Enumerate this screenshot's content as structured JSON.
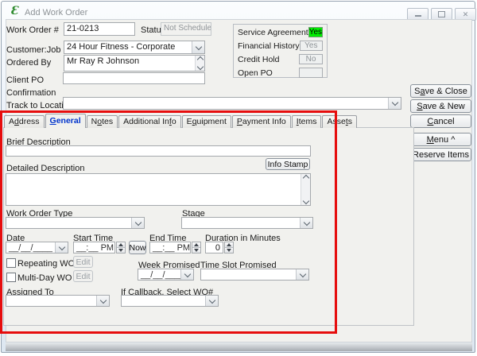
{
  "window": {
    "title": "Add Work Order",
    "logo_icon": "script-e-logo",
    "logo_glyph": "Ɛ",
    "controls": [
      {
        "name": "minimize"
      },
      {
        "name": "maximize"
      },
      {
        "name": "close",
        "glyph": "✕"
      }
    ]
  },
  "colors": {
    "service_agreement_green": "#00ee00",
    "annotation_red": "#e60d0d",
    "selected_tab_blue": "#0033cc"
  },
  "fields": {
    "work_order_number": {
      "label": "Work Order #",
      "value": "21-0213"
    },
    "status": {
      "label": "Status",
      "value": "Not Scheduled"
    },
    "customer_job": {
      "label": "Customer:Job",
      "value": "24 Hour Fitness - Corporate"
    },
    "ordered_by": {
      "label": "Ordered By",
      "value": "Mr Ray R Johnson"
    },
    "client_po": {
      "label": "Client PO",
      "value": ""
    },
    "confirmation": {
      "label": "Confirmation"
    },
    "track_to_location": {
      "label": "Track to Location",
      "value": ""
    }
  },
  "summary_panel": {
    "rows": [
      {
        "label": "Service Agreement",
        "value": "Yes",
        "state": "highlight"
      },
      {
        "label": "Financial History",
        "value": "Yes",
        "state": "normal"
      },
      {
        "label": "Credit Hold",
        "value": "No",
        "state": "normal"
      },
      {
        "label": "Open PO",
        "value": "",
        "state": "normal"
      }
    ]
  },
  "action_buttons": [
    {
      "label": "S&ave && Close"
    },
    {
      "label": "&Save && New"
    },
    {
      "label": "&Cancel"
    },
    {
      "label": "&Menu ^"
    },
    {
      "label": "Reserve Items"
    }
  ],
  "tab_bar": {
    "selected": "General",
    "tabs": [
      {
        "label": "A&ddress"
      },
      {
        "label": "&General",
        "selected": true
      },
      {
        "label": "N&otes"
      },
      {
        "label": "Additional In&fo"
      },
      {
        "label": "E&quipment"
      },
      {
        "label": "&Payment Info"
      },
      {
        "label": "&Items"
      },
      {
        "label": "Asse&ts"
      }
    ]
  },
  "general_tab": {
    "brief_description": {
      "label": "Brief Description",
      "value": ""
    },
    "info_stamp_button": "Info Stamp",
    "detailed_description": {
      "label": "Detailed Description",
      "value": ""
    },
    "work_order_type": {
      "label": "Work Order Type",
      "value": ""
    },
    "stage": {
      "label": "Stage",
      "value": ""
    },
    "date": {
      "label": "Date",
      "value": "__/__/____"
    },
    "start_time": {
      "label": "Start Time",
      "value": "__:__ PM"
    },
    "now_button": "Now",
    "end_time": {
      "label": "End Time",
      "value": "__:__ PM"
    },
    "duration": {
      "label": "Duration in Minutes",
      "value": "0"
    },
    "repeating_wo": {
      "label": "Repeating WO",
      "checked": false,
      "edit_button": "Edit"
    },
    "multi_day_wo": {
      "label": "Multi-Day WO",
      "checked": false,
      "edit_button": "Edit"
    },
    "week_promised": {
      "label": "Week Promised",
      "value": "__/__/____"
    },
    "time_slot_promised": {
      "label": "Time Slot Promised",
      "value": ""
    },
    "assigned_to": {
      "label": "Assigned To",
      "value": ""
    },
    "if_callback": {
      "label": "If Callback, Select WO#",
      "value": ""
    }
  }
}
